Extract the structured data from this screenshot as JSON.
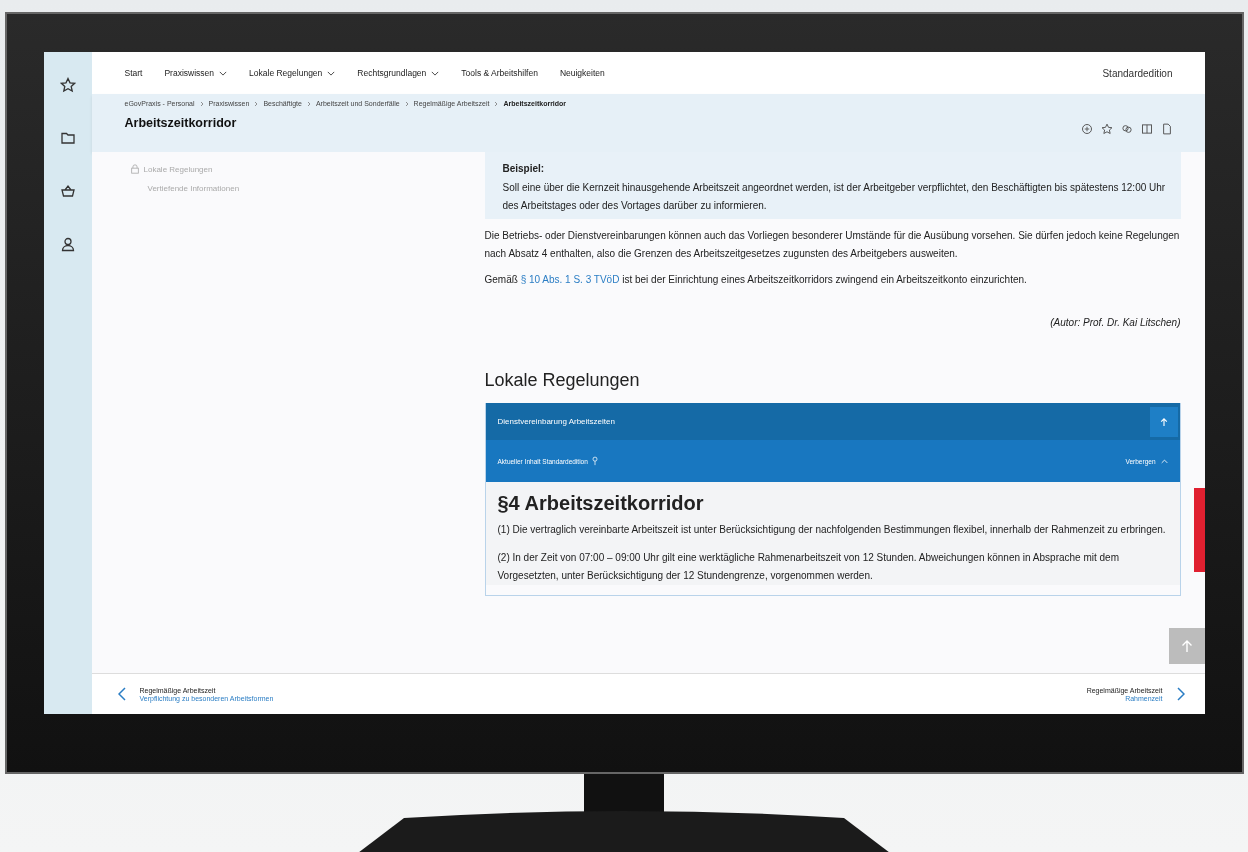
{
  "nav": {
    "items": [
      {
        "label": "Start",
        "has_menu": false
      },
      {
        "label": "Praxiswissen",
        "has_menu": true
      },
      {
        "label": "Lokale Regelungen",
        "has_menu": true
      },
      {
        "label": "Rechtsgrundlagen",
        "has_menu": true
      },
      {
        "label": "Tools & Arbeitshilfen",
        "has_menu": false
      },
      {
        "label": "Neuigkeiten",
        "has_menu": false
      }
    ],
    "edition": "Standardedition"
  },
  "breadcrumbs": [
    {
      "label": "eGovPraxis - Personal",
      "current": false
    },
    {
      "label": "Praxiswissen",
      "current": false
    },
    {
      "label": "Beschäftigte",
      "current": false
    },
    {
      "label": "Arbeitszeit und Sonderfälle",
      "current": false
    },
    {
      "label": "Regelmäßige Arbeitszeit",
      "current": false
    },
    {
      "label": "Arbeitszeitkorridor",
      "current": true
    }
  ],
  "title": "Arbeitszeitkorridor",
  "sidebar": {
    "items": [
      {
        "label": "Lokale Regelungen",
        "kind": "lock"
      },
      {
        "label": "Vertiefende Informationen",
        "kind": "plain"
      }
    ]
  },
  "example": {
    "title": "Beispiel:",
    "text": "Soll eine über die Kernzeit hinausgehende Arbeitszeit angeordnet werden, ist der Arbeitgeber verpflichtet, den Beschäftigten bis spätestens 12:00 Uhr des Arbeitstages oder des Vortages darüber zu informieren."
  },
  "paragraph": "Die Betriebs- oder Dienstvereinbarungen können auch das Vorliegen besonderer Umstände für die Ausübung vorsehen. Sie dürfen jedoch keine Regelungen nach Absatz 4 enthalten, also die Grenzen des Arbeitszeitgesetzes zugunsten des Arbeitgebers ausweiten.",
  "link_paragraph": {
    "before": "Gemäß",
    "link": "§ 10 Abs. 1 S. 3 TVöD",
    "after": "ist bei der Einrichtung eines Arbeitszeitkorridors zwingend ein Arbeitszeitkonto einzurichten."
  },
  "author": "(Autor: Prof. Dr. Kai Litschen)",
  "local_rules": {
    "heading": "Lokale Regelungen",
    "panel_title": "Dienstvereinbarung Arbeitszeiten",
    "content_label": "Aktueller Inhalt Standardedition",
    "toggle": "Verbergen",
    "expanded": true,
    "article_title": "§4 Arbeitszeitkorridor",
    "paragraphs": [
      "(1) Die vertraglich vereinbarte Arbeitszeit ist unter Berücksichtigung der nachfolgenden Bestimmungen flexibel, innerhalb der Rahmenzeit zu erbringen.",
      "(2) In der Zeit von 07:00 – 09:00 Uhr gilt eine werktägliche Rahmenarbeitszeit von 12 Stunden. Abweichungen können in Absprache mit dem Vorgesetzten, unter Berücksichtigung der 12 Stundengrenze, vorgenommen werden."
    ]
  },
  "footer": {
    "previous": {
      "label": "Regelmäßige Arbeitszeit",
      "link": "Verpflichtung zu besonderen Arbeitsformen"
    },
    "next": {
      "label": "Regelmäßige Arbeitszeit",
      "link": "Rahmenzeit"
    }
  }
}
